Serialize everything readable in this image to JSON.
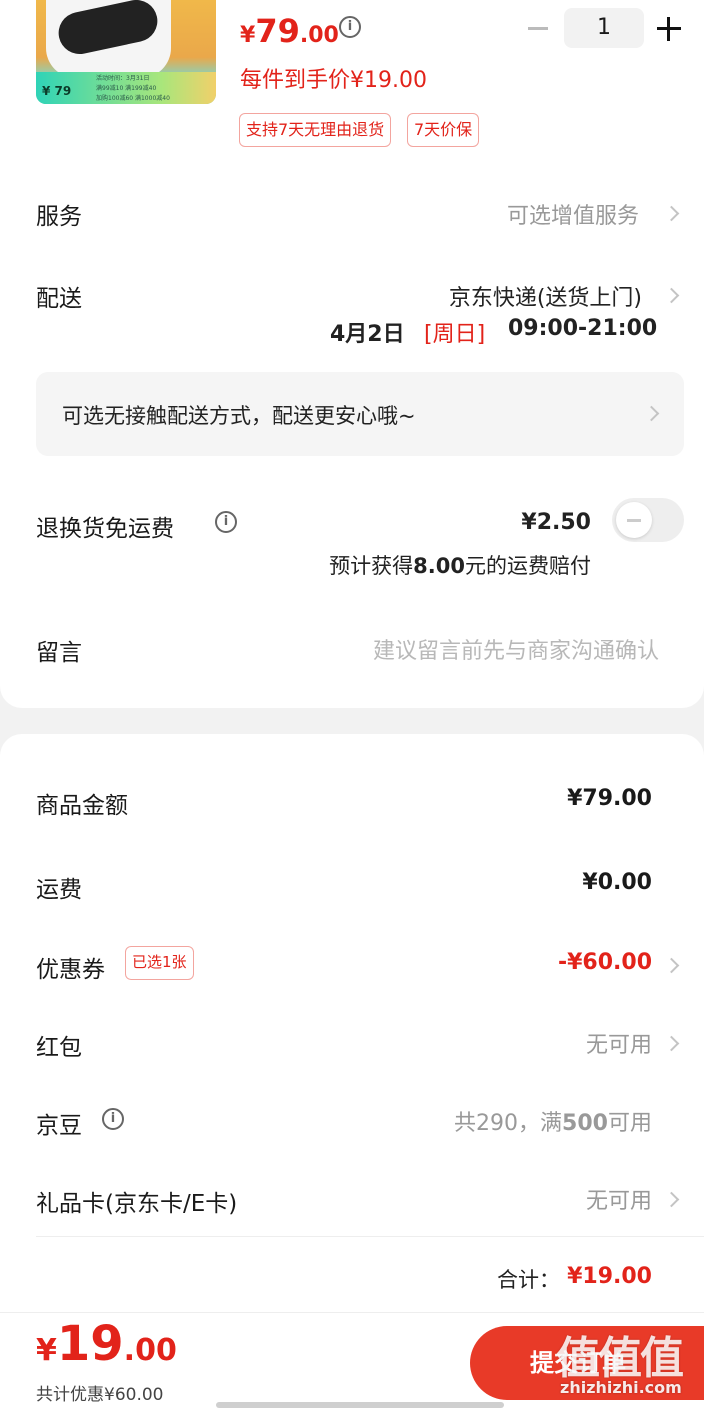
{
  "product": {
    "thumb_price": "79",
    "thumb_lines": [
      "活动时间：3月31日",
      "满99减10 满199减40",
      "加购100减60 满1000减40"
    ],
    "price_currency": "¥",
    "price_int": "79",
    "price_dec": ".00",
    "each_price": "每件到手价¥19.00",
    "tags": [
      "支持7天无理由退货",
      "7天价保"
    ],
    "quantity": "1"
  },
  "service": {
    "label": "服务",
    "value": "可选增值服务"
  },
  "delivery": {
    "label": "配送",
    "method": "京东快递(送货上门)",
    "date": "4月2日",
    "weekday": "[周日]",
    "time": "09:00-21:00",
    "contactless": "可选无接触配送方式，配送更安心哦~"
  },
  "return_shipping": {
    "label": "退换货免运费",
    "price": "¥2.50",
    "note_prefix": "预计获得",
    "note_amount": "8.00",
    "note_suffix": "元的运费赔付",
    "enabled": false
  },
  "message": {
    "label": "留言",
    "placeholder": "建议留言前先与商家沟通确认"
  },
  "summary": {
    "goods_label": "商品金额",
    "goods_value": "¥79.00",
    "shipping_label": "运费",
    "shipping_value": "¥0.00",
    "coupon_label": "优惠券",
    "coupon_badge": "已选1张",
    "coupon_value": "-¥60.00",
    "redpacket_label": "红包",
    "redpacket_value": "无可用",
    "jingdou_label": "京豆",
    "jingdou_value_prefix": "共290，满",
    "jingdou_value_num": "500",
    "jingdou_value_suffix": "可用",
    "giftcard_label": "礼品卡(京东卡/E卡)",
    "giftcard_value": "无可用",
    "total_label": "合计：",
    "total_value": "¥19.00"
  },
  "footer": {
    "currency": "¥",
    "total_int": "19",
    "total_dec": ".00",
    "saved": "共计优惠¥60.00",
    "submit_label": "提交订单"
  },
  "watermark": {
    "big": "值值值",
    "small": "zhizhizhi.com"
  },
  "colors": {
    "accent": "#e2231a",
    "submit_bg": "#e83a28",
    "muted": "#999999"
  }
}
